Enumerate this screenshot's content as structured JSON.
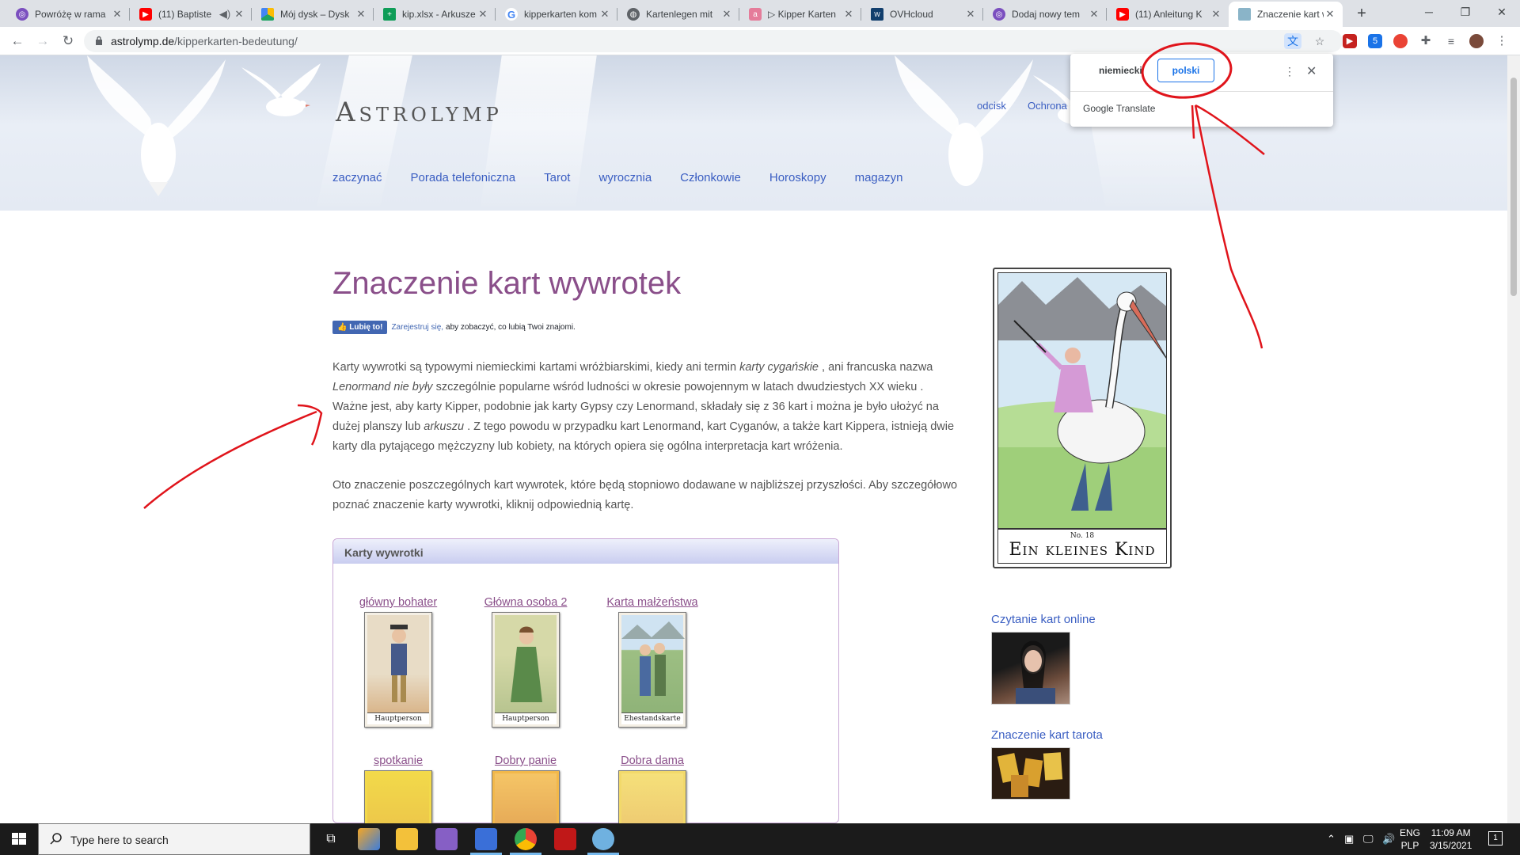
{
  "browser": {
    "tabs": [
      {
        "title": "Powróżę w rama",
        "fav_color": "#7b4fbf",
        "active": false
      },
      {
        "title": "(11) Baptiste",
        "fav_color": "#ff0000",
        "active": false
      },
      {
        "title": "Mój dysk – Dysk",
        "fav_color": "#1fa463",
        "active": false
      },
      {
        "title": "kip.xlsx - Arkusze",
        "fav_color": "#0f9d58",
        "active": false
      },
      {
        "title": "kipperkarten kom",
        "fav_color": "#4285f4",
        "active": false
      },
      {
        "title": "Kartenlegen mit",
        "fav_color": "#5f6368",
        "active": false
      },
      {
        "title": "▷ Kipper Karten",
        "fav_color": "#e57c9a",
        "active": false
      },
      {
        "title": "OVHcloud",
        "fav_color": "#123f6d",
        "active": false
      },
      {
        "title": "Dodaj nowy tem",
        "fav_color": "#7b4fbf",
        "active": false
      },
      {
        "title": "(11) Anleitung K",
        "fav_color": "#ff0000",
        "active": false
      },
      {
        "title": "Znaczenie kart w",
        "fav_color": "#8ab4c8",
        "active": true
      }
    ],
    "new_tab": "+",
    "url_domain": "astrolymp.de",
    "url_path": "/kipperkarten-bedeutung/",
    "ext_badge": "5"
  },
  "translate_popup": {
    "source_lang": "niemiecki",
    "target_lang": "polski",
    "brand": "Google Translate"
  },
  "site": {
    "logo": "Astrolymp",
    "top_links": [
      "odcisk",
      "Ochrona"
    ],
    "nav": [
      "zaczynać",
      "Porada telefoniczna",
      "Tarot",
      "wyrocznia",
      "Członkowie",
      "Horoskopy",
      "magazyn"
    ]
  },
  "article": {
    "title": "Znaczenie kart wywrotek",
    "fb_like": "Lubię to!",
    "fb_signup": "Zarejestruj się,",
    "fb_text": "aby zobaczyć, co lubią Twoi znajomi.",
    "p1_a": "Karty wywrotki są typowymi niemieckimi kartami wróżbiarskimi, kiedy ani termin ",
    "p1_i1": "karty cygańskie",
    "p1_b": " , ani francuska nazwa ",
    "p1_i2": "Lenormand nie były",
    "p1_c": " szczególnie popularne wśród ludności w okresie powojennym w latach dwudziestych XX wieku . Ważne jest, aby karty Kipper, podobnie jak karty Gypsy czy Lenormand, składały się z 36 kart i można je było ułożyć na dużej planszy lub ",
    "p1_i3": "arkuszu",
    "p1_d": " . Z tego powodu w przypadku kart Lenormand, kart Cyganów, a także kart Kippera, istnieją dwie karty dla pytającego mężczyzny lub kobiety, na których opiera się ogólna interpretacja kart wróżenia.",
    "p2": "Oto znaczenie poszczególnych kart wywrotek, które będą stopniowo dodawane w najbliższej przyszłości. Aby szczegółowo poznać znaczenie karty wywrotki, kliknij odpowiednią kartę.",
    "box_title": "Karty wywrotki",
    "cards": [
      {
        "label": "główny bohater",
        "caption": "Hauptperson"
      },
      {
        "label": "Główna osoba 2",
        "caption": "Hauptperson"
      },
      {
        "label": "Karta małżeństwa",
        "caption": "Ehestandskarte"
      },
      {
        "label": "spotkanie",
        "caption": ""
      },
      {
        "label": "Dobry panie",
        "caption": ""
      },
      {
        "label": "Dobra dama",
        "caption": ""
      }
    ]
  },
  "sidebar": {
    "card_number": "No. 18",
    "card_name": "Ein kleines Kind",
    "link1": "Czytanie kart online",
    "link2": "Znaczenie kart tarota"
  },
  "taskbar": {
    "search_placeholder": "Type here to search",
    "lang_top": "ENG",
    "lang_bottom": "PLP",
    "time": "11:09 AM",
    "date": "3/15/2021",
    "notifications": "1"
  },
  "annotation_color": "#e0141b"
}
